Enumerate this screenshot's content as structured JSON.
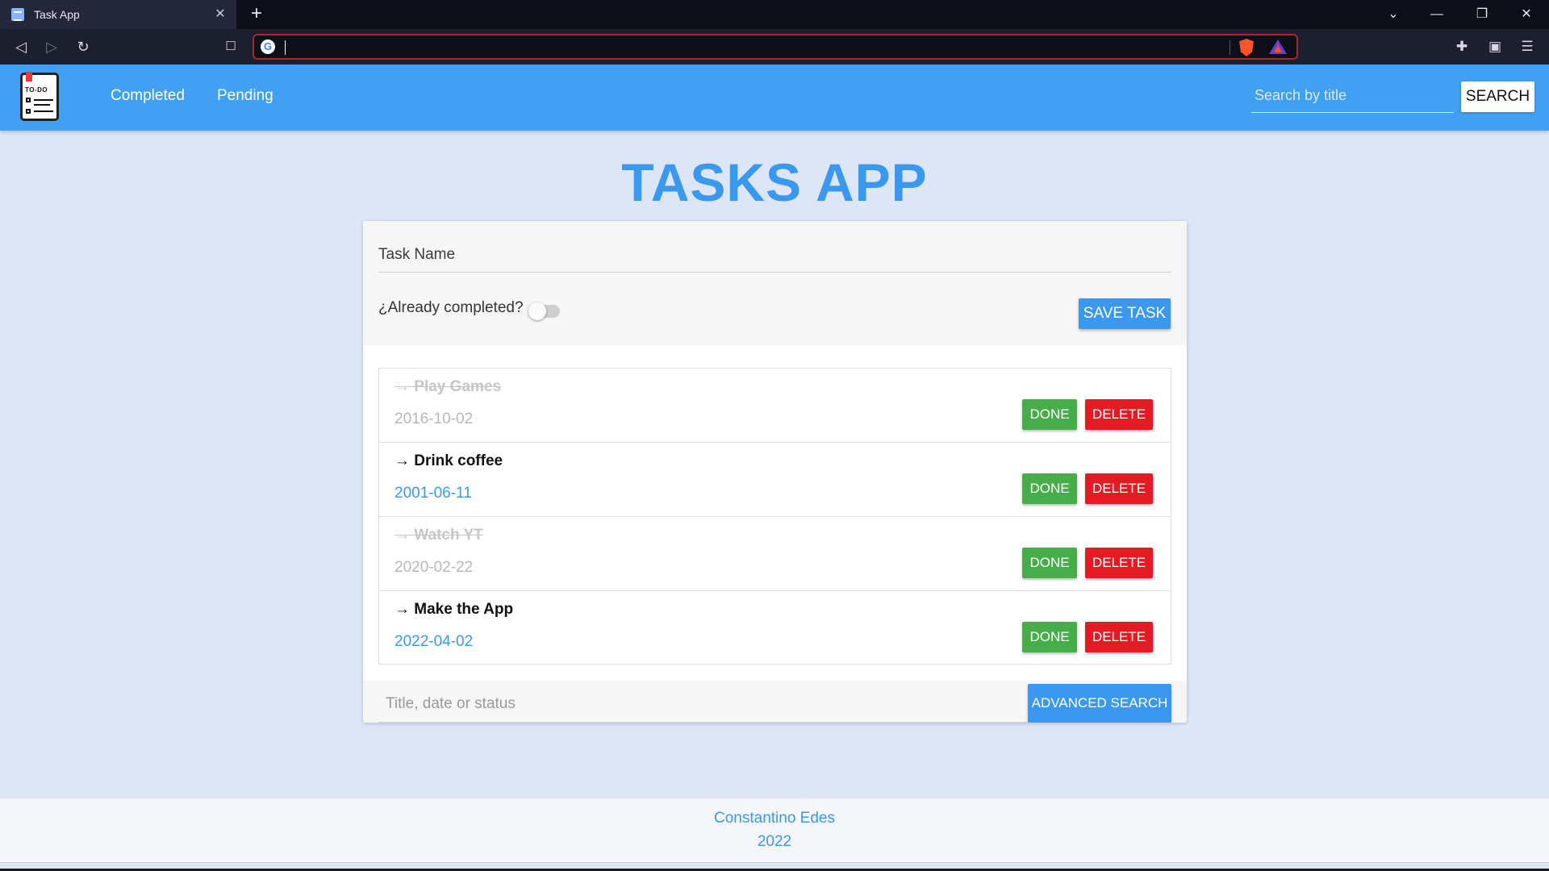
{
  "browser": {
    "tab_title": "Task App",
    "tab_close": "✕",
    "new_tab": "+",
    "address": "",
    "controls": {
      "dropdown": "⌄",
      "minimize": "—",
      "restore": "❐",
      "close": "✕"
    },
    "nav": {
      "back": "◁",
      "forward": "▷",
      "reload": "↻",
      "bookmark": "🔖"
    },
    "tools": {
      "extensions": "✚",
      "wallet": "▣",
      "menu": "☰"
    }
  },
  "navbar": {
    "logo_text": "TO-DO",
    "links": [
      "Completed",
      "Pending"
    ],
    "search_placeholder": "Search by title",
    "search_button": "SEARCH"
  },
  "page": {
    "title": "TASKS APP"
  },
  "form": {
    "task_name_placeholder": "Task Name",
    "completed_label": "¿Already completed?",
    "completed_value": false,
    "save_button": "SAVE TASK"
  },
  "tasks": [
    {
      "title": "→ Play Games",
      "date": "2016-10-02",
      "completed": true
    },
    {
      "title": "→ Drink coffee",
      "date": "2001-06-11",
      "completed": false
    },
    {
      "title": "→ Watch YT",
      "date": "2020-02-22",
      "completed": true
    },
    {
      "title": "→ Make the App",
      "date": "2022-04-02",
      "completed": false
    }
  ],
  "task_actions": {
    "done": "DONE",
    "delete": "DELETE"
  },
  "advanced_search": {
    "placeholder": "Title, date or status",
    "button": "ADVANCED SEARCH"
  },
  "footer": {
    "author": "Constantino Edes",
    "year": "2022"
  },
  "colors": {
    "primary": "#42a0f3",
    "title_blue": "#3a98ef",
    "done_green": "#47ad4b",
    "delete_red": "#e31c24",
    "page_bg": "#dce6f7"
  }
}
